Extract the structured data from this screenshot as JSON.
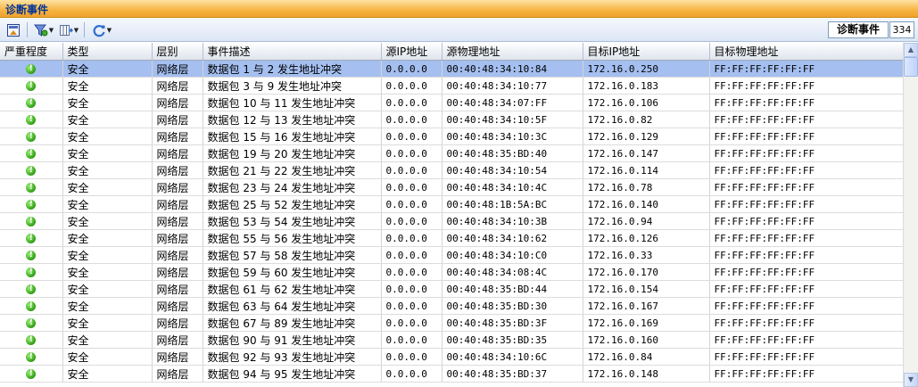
{
  "window": {
    "title": "诊断事件"
  },
  "toolbar": {
    "diag_label": "诊断事件",
    "diag_count": "334",
    "buttons": [
      {
        "name": "export-icon"
      },
      {
        "name": "filter-icon"
      },
      {
        "name": "columns-icon"
      },
      {
        "name": "refresh-icon"
      }
    ]
  },
  "columns": [
    "严重程度",
    "类型",
    "层别",
    "事件描述",
    "源IP地址",
    "源物理地址",
    "目标IP地址",
    "目标物理地址"
  ],
  "rows": [
    {
      "severity": "ok",
      "type": "安全",
      "layer": "网络层",
      "desc": "数据包 1 与 2 发生地址冲突",
      "src_ip": "0.0.0.0",
      "src_mac": "00:40:48:34:10:84",
      "dst_ip": "172.16.0.250",
      "dst_mac": "FF:FF:FF:FF:FF:FF"
    },
    {
      "severity": "ok",
      "type": "安全",
      "layer": "网络层",
      "desc": "数据包 3 与 9 发生地址冲突",
      "src_ip": "0.0.0.0",
      "src_mac": "00:40:48:34:10:77",
      "dst_ip": "172.16.0.183",
      "dst_mac": "FF:FF:FF:FF:FF:FF"
    },
    {
      "severity": "ok",
      "type": "安全",
      "layer": "网络层",
      "desc": "数据包 10 与 11 发生地址冲突",
      "src_ip": "0.0.0.0",
      "src_mac": "00:40:48:34:07:FF",
      "dst_ip": "172.16.0.106",
      "dst_mac": "FF:FF:FF:FF:FF:FF"
    },
    {
      "severity": "ok",
      "type": "安全",
      "layer": "网络层",
      "desc": "数据包 12 与 13 发生地址冲突",
      "src_ip": "0.0.0.0",
      "src_mac": "00:40:48:34:10:5F",
      "dst_ip": "172.16.0.82",
      "dst_mac": "FF:FF:FF:FF:FF:FF"
    },
    {
      "severity": "ok",
      "type": "安全",
      "layer": "网络层",
      "desc": "数据包 15 与 16 发生地址冲突",
      "src_ip": "0.0.0.0",
      "src_mac": "00:40:48:34:10:3C",
      "dst_ip": "172.16.0.129",
      "dst_mac": "FF:FF:FF:FF:FF:FF"
    },
    {
      "severity": "ok",
      "type": "安全",
      "layer": "网络层",
      "desc": "数据包 19 与 20 发生地址冲突",
      "src_ip": "0.0.0.0",
      "src_mac": "00:40:48:35:BD:40",
      "dst_ip": "172.16.0.147",
      "dst_mac": "FF:FF:FF:FF:FF:FF"
    },
    {
      "severity": "ok",
      "type": "安全",
      "layer": "网络层",
      "desc": "数据包 21 与 22 发生地址冲突",
      "src_ip": "0.0.0.0",
      "src_mac": "00:40:48:34:10:54",
      "dst_ip": "172.16.0.114",
      "dst_mac": "FF:FF:FF:FF:FF:FF"
    },
    {
      "severity": "ok",
      "type": "安全",
      "layer": "网络层",
      "desc": "数据包 23 与 24 发生地址冲突",
      "src_ip": "0.0.0.0",
      "src_mac": "00:40:48:34:10:4C",
      "dst_ip": "172.16.0.78",
      "dst_mac": "FF:FF:FF:FF:FF:FF"
    },
    {
      "severity": "ok",
      "type": "安全",
      "layer": "网络层",
      "desc": "数据包 25 与 52 发生地址冲突",
      "src_ip": "0.0.0.0",
      "src_mac": "00:40:48:1B:5A:BC",
      "dst_ip": "172.16.0.140",
      "dst_mac": "FF:FF:FF:FF:FF:FF"
    },
    {
      "severity": "ok",
      "type": "安全",
      "layer": "网络层",
      "desc": "数据包 53 与 54 发生地址冲突",
      "src_ip": "0.0.0.0",
      "src_mac": "00:40:48:34:10:3B",
      "dst_ip": "172.16.0.94",
      "dst_mac": "FF:FF:FF:FF:FF:FF"
    },
    {
      "severity": "ok",
      "type": "安全",
      "layer": "网络层",
      "desc": "数据包 55 与 56 发生地址冲突",
      "src_ip": "0.0.0.0",
      "src_mac": "00:40:48:34:10:62",
      "dst_ip": "172.16.0.126",
      "dst_mac": "FF:FF:FF:FF:FF:FF"
    },
    {
      "severity": "ok",
      "type": "安全",
      "layer": "网络层",
      "desc": "数据包 57 与 58 发生地址冲突",
      "src_ip": "0.0.0.0",
      "src_mac": "00:40:48:34:10:C0",
      "dst_ip": "172.16.0.33",
      "dst_mac": "FF:FF:FF:FF:FF:FF"
    },
    {
      "severity": "ok",
      "type": "安全",
      "layer": "网络层",
      "desc": "数据包 59 与 60 发生地址冲突",
      "src_ip": "0.0.0.0",
      "src_mac": "00:40:48:34:08:4C",
      "dst_ip": "172.16.0.170",
      "dst_mac": "FF:FF:FF:FF:FF:FF"
    },
    {
      "severity": "ok",
      "type": "安全",
      "layer": "网络层",
      "desc": "数据包 61 与 62 发生地址冲突",
      "src_ip": "0.0.0.0",
      "src_mac": "00:40:48:35:BD:44",
      "dst_ip": "172.16.0.154",
      "dst_mac": "FF:FF:FF:FF:FF:FF"
    },
    {
      "severity": "ok",
      "type": "安全",
      "layer": "网络层",
      "desc": "数据包 63 与 64 发生地址冲突",
      "src_ip": "0.0.0.0",
      "src_mac": "00:40:48:35:BD:30",
      "dst_ip": "172.16.0.167",
      "dst_mac": "FF:FF:FF:FF:FF:FF"
    },
    {
      "severity": "ok",
      "type": "安全",
      "layer": "网络层",
      "desc": "数据包 67 与 89 发生地址冲突",
      "src_ip": "0.0.0.0",
      "src_mac": "00:40:48:35:BD:3F",
      "dst_ip": "172.16.0.169",
      "dst_mac": "FF:FF:FF:FF:FF:FF"
    },
    {
      "severity": "ok",
      "type": "安全",
      "layer": "网络层",
      "desc": "数据包 90 与 91 发生地址冲突",
      "src_ip": "0.0.0.0",
      "src_mac": "00:40:48:35:BD:35",
      "dst_ip": "172.16.0.160",
      "dst_mac": "FF:FF:FF:FF:FF:FF"
    },
    {
      "severity": "ok",
      "type": "安全",
      "layer": "网络层",
      "desc": "数据包 92 与 93 发生地址冲突",
      "src_ip": "0.0.0.0",
      "src_mac": "00:40:48:34:10:6C",
      "dst_ip": "172.16.0.84",
      "dst_mac": "FF:FF:FF:FF:FF:FF"
    },
    {
      "severity": "ok",
      "type": "安全",
      "layer": "网络层",
      "desc": "数据包 94 与 95 发生地址冲突",
      "src_ip": "0.0.0.0",
      "src_mac": "00:40:48:35:BD:37",
      "dst_ip": "172.16.0.148",
      "dst_mac": "FF:FF:FF:FF:FF:FF"
    }
  ],
  "selected_row": 0,
  "colors": {
    "accent_title": "#003399",
    "selection": "#a4bff0",
    "severity_ok": "#2f9e12"
  }
}
